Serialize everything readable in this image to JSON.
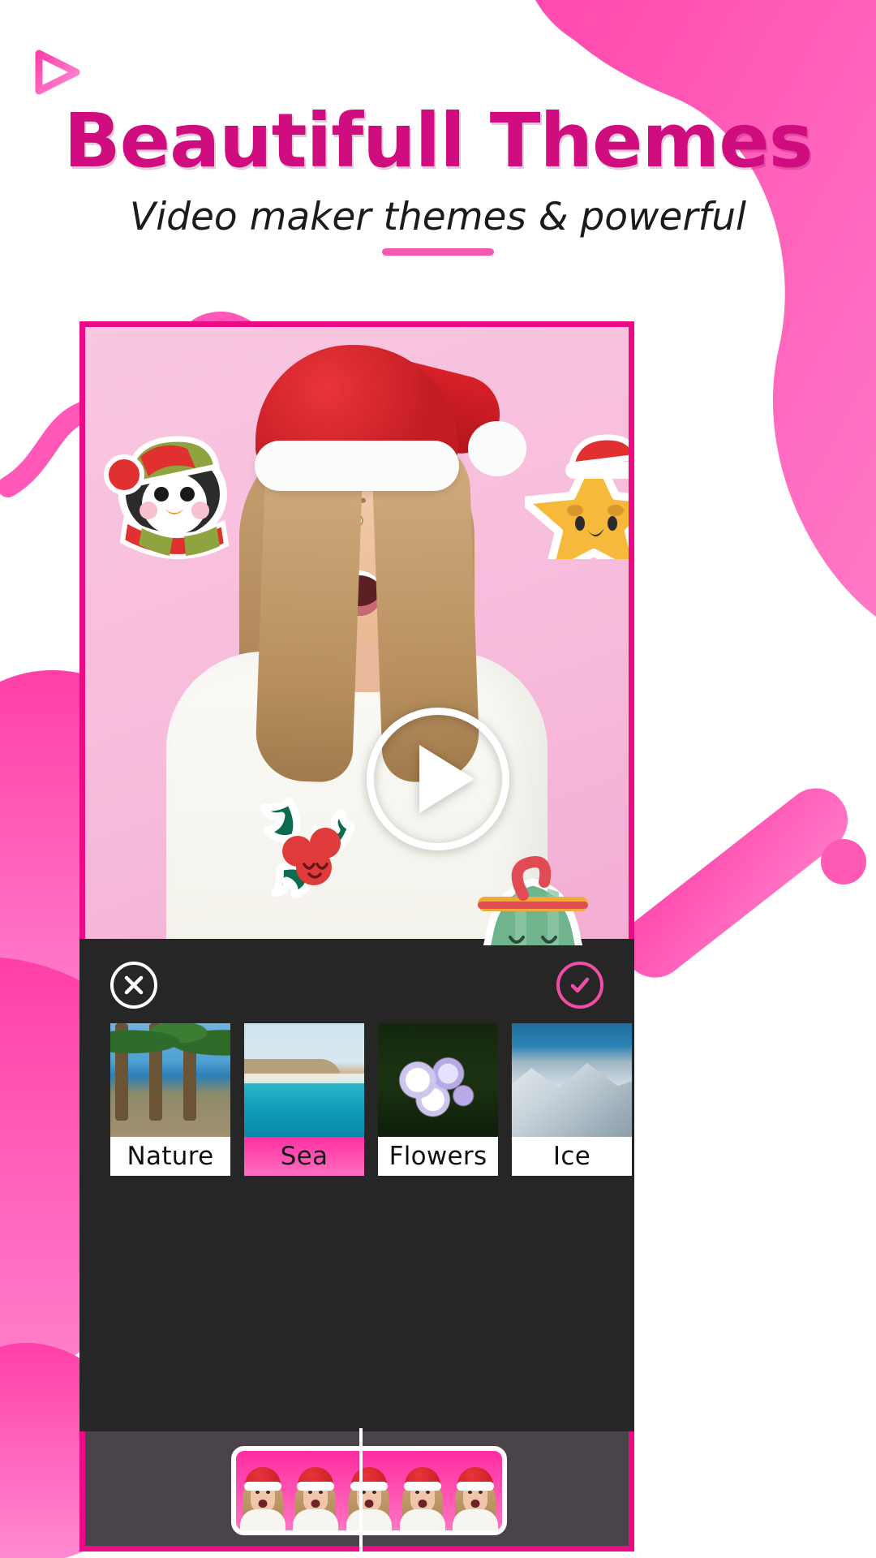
{
  "brand": {
    "logo_icon": "play-triangle-logo",
    "accent": "#ec0a86",
    "accent_light": "#f558b0"
  },
  "header": {
    "title": "Beautifull Themes",
    "subtitle": "Video maker themes & powerful"
  },
  "preview": {
    "play_button_icon": "play-icon",
    "frame_border_color": "#ec0a86",
    "background_color": "#f7bcdb",
    "stickers": [
      {
        "name": "penguin-sticker",
        "label": "penguin"
      },
      {
        "name": "star-sticker",
        "label": "star"
      },
      {
        "name": "holly-sticker",
        "label": "holly"
      },
      {
        "name": "bell-sticker",
        "label": "bell"
      }
    ]
  },
  "editor": {
    "background_color": "#262626",
    "close_icon": "close-icon",
    "confirm_icon": "check-icon",
    "confirm_color": "#ef4da6",
    "themes": [
      {
        "label": "Nature",
        "selected": false,
        "thumb": "th-nature"
      },
      {
        "label": "Sea",
        "selected": true,
        "thumb": "th-sea"
      },
      {
        "label": "Flowers",
        "selected": false,
        "thumb": "th-flowers"
      },
      {
        "label": "Ice",
        "selected": false,
        "thumb": "th-ice"
      }
    ]
  },
  "timeline": {
    "background_color": "#4a444a",
    "clip_background": "#ff2da1",
    "frame_count": 5,
    "playhead_position": "center"
  }
}
